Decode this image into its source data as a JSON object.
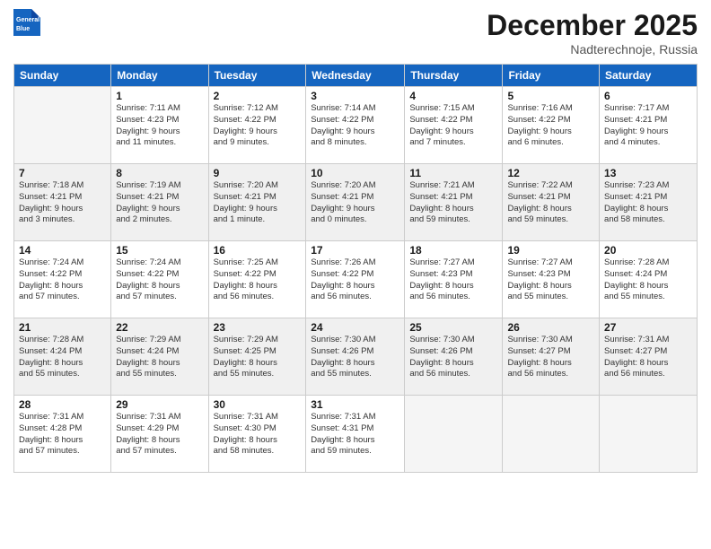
{
  "header": {
    "logo_line1": "General",
    "logo_line2": "Blue",
    "month": "December 2025",
    "location": "Nadterechnoje, Russia"
  },
  "weekdays": [
    "Sunday",
    "Monday",
    "Tuesday",
    "Wednesday",
    "Thursday",
    "Friday",
    "Saturday"
  ],
  "weeks": [
    [
      {
        "day": "",
        "info": ""
      },
      {
        "day": "1",
        "info": "Sunrise: 7:11 AM\nSunset: 4:23 PM\nDaylight: 9 hours\nand 11 minutes."
      },
      {
        "day": "2",
        "info": "Sunrise: 7:12 AM\nSunset: 4:22 PM\nDaylight: 9 hours\nand 9 minutes."
      },
      {
        "day": "3",
        "info": "Sunrise: 7:14 AM\nSunset: 4:22 PM\nDaylight: 9 hours\nand 8 minutes."
      },
      {
        "day": "4",
        "info": "Sunrise: 7:15 AM\nSunset: 4:22 PM\nDaylight: 9 hours\nand 7 minutes."
      },
      {
        "day": "5",
        "info": "Sunrise: 7:16 AM\nSunset: 4:22 PM\nDaylight: 9 hours\nand 6 minutes."
      },
      {
        "day": "6",
        "info": "Sunrise: 7:17 AM\nSunset: 4:21 PM\nDaylight: 9 hours\nand 4 minutes."
      }
    ],
    [
      {
        "day": "7",
        "info": "Sunrise: 7:18 AM\nSunset: 4:21 PM\nDaylight: 9 hours\nand 3 minutes."
      },
      {
        "day": "8",
        "info": "Sunrise: 7:19 AM\nSunset: 4:21 PM\nDaylight: 9 hours\nand 2 minutes."
      },
      {
        "day": "9",
        "info": "Sunrise: 7:20 AM\nSunset: 4:21 PM\nDaylight: 9 hours\nand 1 minute."
      },
      {
        "day": "10",
        "info": "Sunrise: 7:20 AM\nSunset: 4:21 PM\nDaylight: 9 hours\nand 0 minutes."
      },
      {
        "day": "11",
        "info": "Sunrise: 7:21 AM\nSunset: 4:21 PM\nDaylight: 8 hours\nand 59 minutes."
      },
      {
        "day": "12",
        "info": "Sunrise: 7:22 AM\nSunset: 4:21 PM\nDaylight: 8 hours\nand 59 minutes."
      },
      {
        "day": "13",
        "info": "Sunrise: 7:23 AM\nSunset: 4:21 PM\nDaylight: 8 hours\nand 58 minutes."
      }
    ],
    [
      {
        "day": "14",
        "info": "Sunrise: 7:24 AM\nSunset: 4:22 PM\nDaylight: 8 hours\nand 57 minutes."
      },
      {
        "day": "15",
        "info": "Sunrise: 7:24 AM\nSunset: 4:22 PM\nDaylight: 8 hours\nand 57 minutes."
      },
      {
        "day": "16",
        "info": "Sunrise: 7:25 AM\nSunset: 4:22 PM\nDaylight: 8 hours\nand 56 minutes."
      },
      {
        "day": "17",
        "info": "Sunrise: 7:26 AM\nSunset: 4:22 PM\nDaylight: 8 hours\nand 56 minutes."
      },
      {
        "day": "18",
        "info": "Sunrise: 7:27 AM\nSunset: 4:23 PM\nDaylight: 8 hours\nand 56 minutes."
      },
      {
        "day": "19",
        "info": "Sunrise: 7:27 AM\nSunset: 4:23 PM\nDaylight: 8 hours\nand 55 minutes."
      },
      {
        "day": "20",
        "info": "Sunrise: 7:28 AM\nSunset: 4:24 PM\nDaylight: 8 hours\nand 55 minutes."
      }
    ],
    [
      {
        "day": "21",
        "info": "Sunrise: 7:28 AM\nSunset: 4:24 PM\nDaylight: 8 hours\nand 55 minutes."
      },
      {
        "day": "22",
        "info": "Sunrise: 7:29 AM\nSunset: 4:24 PM\nDaylight: 8 hours\nand 55 minutes."
      },
      {
        "day": "23",
        "info": "Sunrise: 7:29 AM\nSunset: 4:25 PM\nDaylight: 8 hours\nand 55 minutes."
      },
      {
        "day": "24",
        "info": "Sunrise: 7:30 AM\nSunset: 4:26 PM\nDaylight: 8 hours\nand 55 minutes."
      },
      {
        "day": "25",
        "info": "Sunrise: 7:30 AM\nSunset: 4:26 PM\nDaylight: 8 hours\nand 56 minutes."
      },
      {
        "day": "26",
        "info": "Sunrise: 7:30 AM\nSunset: 4:27 PM\nDaylight: 8 hours\nand 56 minutes."
      },
      {
        "day": "27",
        "info": "Sunrise: 7:31 AM\nSunset: 4:27 PM\nDaylight: 8 hours\nand 56 minutes."
      }
    ],
    [
      {
        "day": "28",
        "info": "Sunrise: 7:31 AM\nSunset: 4:28 PM\nDaylight: 8 hours\nand 57 minutes."
      },
      {
        "day": "29",
        "info": "Sunrise: 7:31 AM\nSunset: 4:29 PM\nDaylight: 8 hours\nand 57 minutes."
      },
      {
        "day": "30",
        "info": "Sunrise: 7:31 AM\nSunset: 4:30 PM\nDaylight: 8 hours\nand 58 minutes."
      },
      {
        "day": "31",
        "info": "Sunrise: 7:31 AM\nSunset: 4:31 PM\nDaylight: 8 hours\nand 59 minutes."
      },
      {
        "day": "",
        "info": ""
      },
      {
        "day": "",
        "info": ""
      },
      {
        "day": "",
        "info": ""
      }
    ]
  ]
}
